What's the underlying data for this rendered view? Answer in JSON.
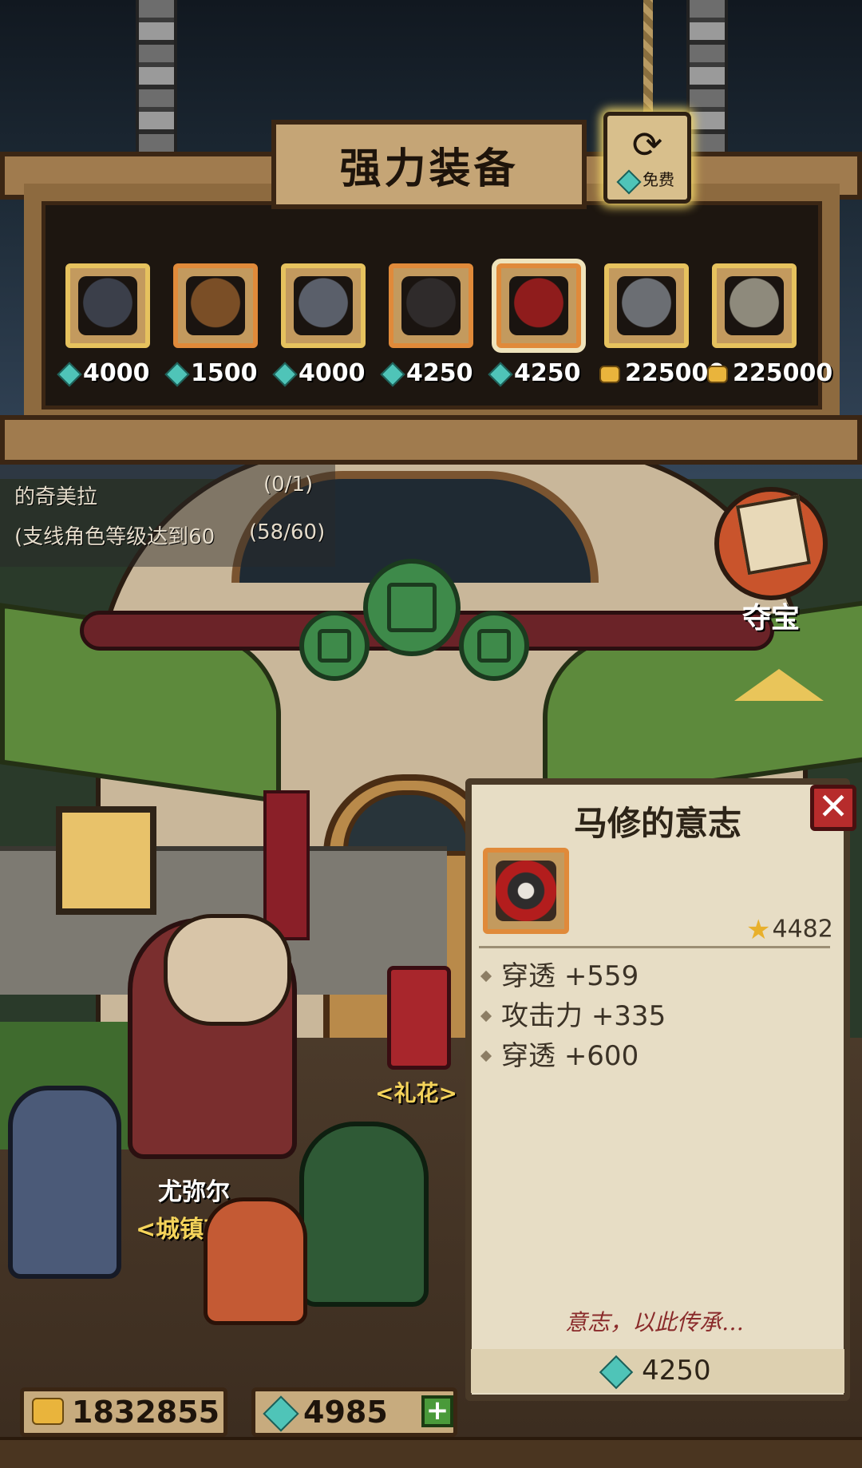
{
  "shop": {
    "title": "强力装备",
    "refresh_label": "免费",
    "items": [
      {
        "price": "4000",
        "currency": "gem",
        "frame": "gold",
        "icon": "dark-helmet-icon",
        "color": "#3b3f4a"
      },
      {
        "price": "1500",
        "currency": "gem",
        "frame": "orange",
        "icon": "wooden-gauntlet-icon",
        "color": "#7a4e26"
      },
      {
        "price": "4000",
        "currency": "gem",
        "frame": "gold",
        "icon": "spiked-blade-icon",
        "color": "#5a5f6a"
      },
      {
        "price": "4250",
        "currency": "gem",
        "frame": "orange",
        "icon": "dark-claw-icon",
        "color": "#2f2b2b"
      },
      {
        "price": "4250",
        "currency": "gem",
        "frame": "orange",
        "icon": "red-tentacle-orb-icon",
        "color": "#8f1c1c",
        "selected": true
      },
      {
        "price": "225000",
        "currency": "coin",
        "frame": "gold",
        "icon": "horned-helmet-icon",
        "color": "#6b6e73"
      },
      {
        "price": "225000",
        "currency": "coin",
        "frame": "gold",
        "icon": "winged-helmet-icon",
        "color": "#8e8a7c"
      }
    ]
  },
  "quests": [
    {
      "text": "的奇美拉",
      "progress": "(0/1)"
    },
    {
      "text": "(支线角色等级达到60",
      "progress": "(58/60)"
    }
  ],
  "treasure": {
    "label": "夺宝"
  },
  "npcs": {
    "merchant_name": "尤弥尔",
    "merchant_title": "<城镇商",
    "gift_label": "<礼花>"
  },
  "detail": {
    "title": "马修的意志",
    "score": "4482",
    "stats": [
      {
        "name": "穿透",
        "value": "+559"
      },
      {
        "name": "攻击力",
        "value": "+335"
      },
      {
        "name": "穿透",
        "value": "+600"
      }
    ],
    "flavor": "意志，以此传承…",
    "price": "4250"
  },
  "resources": {
    "coins": "1832855",
    "gems": "4985"
  },
  "colors": {
    "gem": "#4fc4b8",
    "coin": "#e9b43c",
    "panel": "#e7ddc5",
    "wood": "#8d6a3f"
  }
}
